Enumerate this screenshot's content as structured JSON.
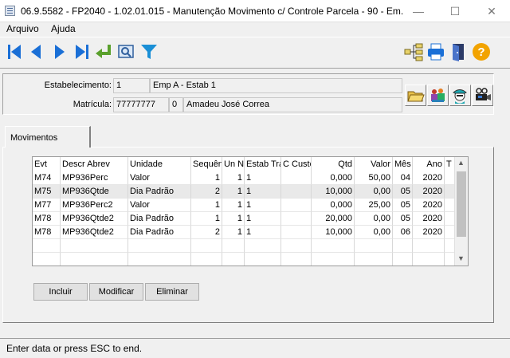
{
  "window": {
    "title": "06.9.5582 - FP2040 - 1.02.01.015 - Manutenção Movimento c/ Controle Parcela - 90 - Em...",
    "minimize": "—",
    "maximize": "☐",
    "close": "✕"
  },
  "menu": {
    "items": [
      "Arquivo",
      "Ajuda"
    ]
  },
  "toolbar": {
    "left_icons": [
      "first-record-icon",
      "previous-record-icon",
      "next-record-icon",
      "last-record-icon",
      "return-icon",
      "search-icon",
      "filter-icon"
    ],
    "right_icons": [
      "hierarchy-icon",
      "print-icon",
      "exit-door-icon",
      "help-icon"
    ]
  },
  "header": {
    "estabelecimento_label": "Estabelecimento:",
    "estabelecimento_code": "1",
    "estabelecimento_name": "Emp A - Estab 1",
    "matricula_label": "Matrícula:",
    "matricula_code": "77777777",
    "matricula_digit": "0",
    "matricula_name": "Amadeu José Correa",
    "side_icons": [
      "folder-open-icon",
      "people-icon",
      "user-cap-icon",
      "projector-icon"
    ]
  },
  "tabs": [
    {
      "label": "Movimentos"
    }
  ],
  "grid": {
    "columns": [
      "Evt",
      "Descr Abrev",
      "Unidade",
      "Sequência",
      "Un Neg",
      "Estab Tra",
      "C Custo",
      "Qtd",
      "Valor",
      "Mês",
      "Ano",
      "T"
    ],
    "rows": [
      [
        "M74",
        "MP936Perc",
        "Valor",
        "1",
        "1",
        "1",
        "",
        "0,000",
        "50,00",
        "04",
        "2020",
        ""
      ],
      [
        "M75",
        "MP936Qtde",
        "Dia Padrão",
        "2",
        "1",
        "1",
        "",
        "10,000",
        "0,00",
        "05",
        "2020",
        ""
      ],
      [
        "M77",
        "MP936Perc2",
        "Valor",
        "1",
        "1",
        "1",
        "",
        "0,000",
        "25,00",
        "05",
        "2020",
        ""
      ],
      [
        "M78",
        "MP936Qtde2",
        "Dia Padrão",
        "1",
        "1",
        "1",
        "",
        "20,000",
        "0,00",
        "05",
        "2020",
        ""
      ],
      [
        "M78",
        "MP936Qtde2",
        "Dia Padrão",
        "2",
        "1",
        "1",
        "",
        "10,000",
        "0,00",
        "06",
        "2020",
        ""
      ]
    ],
    "selected_row": 1
  },
  "actions": {
    "incluir": "Incluir",
    "modificar": "Modificar",
    "eliminar": "Eliminar"
  },
  "status": {
    "text": "Enter data or press ESC to end."
  },
  "colors": {
    "nav_blue": "#1a6fd6",
    "return_green": "#5aa02c",
    "help_orange": "#f2a300"
  }
}
